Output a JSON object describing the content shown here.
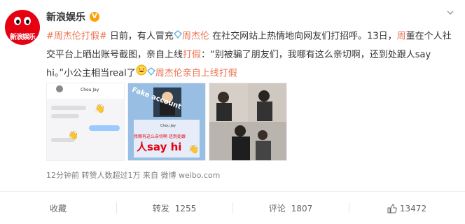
{
  "account": {
    "name": "新浪娱乐",
    "avatar_text": "新浪娱乐"
  },
  "post": {
    "topic": "#周杰伦打假#",
    "text_1": " 日前，有人冒充",
    "mention_1": "周杰伦",
    "text_2": " 在社交网站上热情地向网友们打招呼。13日，",
    "highlight_1": "周",
    "text_3": "董在个人社交平台上晒出账号截图，亲自上线",
    "highlight_2": "打假",
    "text_4": "：“别被骗了朋友们，我哪有这么亲切啊，还到处跟人say hi。”小公主相当real了",
    "mention_2": "周杰伦",
    "text_5": "亲自上线",
    "highlight_3": "打假"
  },
  "images": [
    {
      "caption_name": "Chou Jay",
      "wave": "👋"
    },
    {
      "overlay_title": "Fake account",
      "name": "Chou Jay",
      "caption": "我哪有这么亲切啊 还到处跟",
      "say_hi": "人say hi"
    },
    {
      "scene": "couple-photos"
    }
  ],
  "meta": {
    "time": "12分钟前",
    "reposts_text": "转赞人数超过1万",
    "source_label": "来自",
    "source": "微博 weibo.com"
  },
  "actions": {
    "favorite_label": "收藏",
    "repost_label": "转发",
    "repost_count": "1255",
    "comment_label": "评论",
    "comment_count": "1807",
    "like_count": "13472"
  },
  "colors": {
    "brand": "#e60012",
    "link": "#eb7350",
    "verified": "#ffa00a"
  }
}
